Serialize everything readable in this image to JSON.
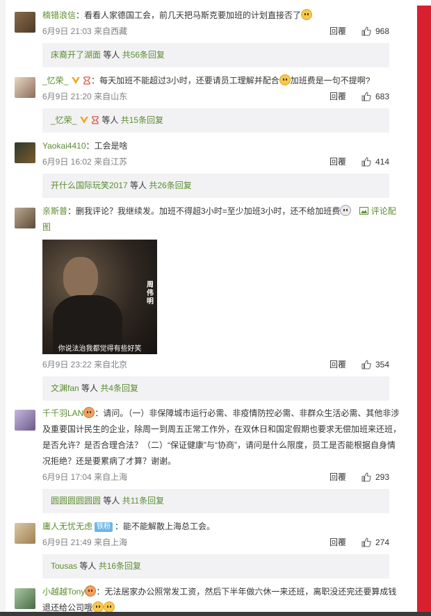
{
  "comments": [
    {
      "user": "楠错浪信",
      "sep": "：",
      "text": "看看人家德国工会，前几天把马斯克要加班的计划直接否了",
      "date": "6月9日 21:03",
      "location": "来自西藏",
      "reply_label": "回覆",
      "likes": "968",
      "reply_user": "床裔开了湖面",
      "reply_mid": " 等人 ",
      "reply_count": "共56条回复"
    },
    {
      "user": "_忆荣_",
      "sep": "：",
      "text": "每天加班不能超过3小时，还要请员工理解并配合",
      "text2": "加班费是一句不提啊?",
      "date": "6月9日 21:20",
      "location": "来自山东",
      "reply_label": "回覆",
      "likes": "683",
      "reply_user": "_忆荣_",
      "reply_mid": " 等人 ",
      "reply_count": "共15条回复"
    },
    {
      "user": "Yaokai4410",
      "sep": "：",
      "text": "工会是啥",
      "date": "6月9日 16:02",
      "location": "来自江苏",
      "reply_label": "回覆",
      "likes": "414",
      "reply_user": "开什么国际玩笑2017",
      "reply_mid": " 等人 ",
      "reply_count": "共26条回复"
    },
    {
      "user": "亲斯普",
      "sep": "：",
      "text": "删我评论？我继续发。加班不得超3小时=至少加班3小时，还不给加班费",
      "pic_label": "评论配图",
      "image_caption": "你说法治我都觉得有些好笑",
      "image_name": "周伟明",
      "date": "6月9日 23:22",
      "location": "来自北京",
      "reply_label": "回覆",
      "likes": "354",
      "reply_user": "文渊fan",
      "reply_mid": " 等人 ",
      "reply_count": "共4条回复"
    },
    {
      "user": "千千羽LAN",
      "sep": "：",
      "text": "请问。（一）非保障城市运行必需、非疫情防控必需、非群众生活必需、其他非涉及重要国计民生的企业，除周一到周五正常工作外，在双休日和国定假期也要求无偿加班来还班，是否允许？是否合理合法？（二）“保证健康”与“协商”，请问是什么限度，员工是否能根据自身情况拒绝？还是要累病了才算？谢谢。",
      "date": "6月9日 17:04",
      "location": "来自上海",
      "reply_label": "回覆",
      "likes": "293",
      "reply_user": "圆圆圆圆圆圆",
      "reply_mid": " 等人 ",
      "reply_count": "共11条回复"
    },
    {
      "user": "庸人无忧无虑",
      "fan_badge": "铁粉",
      "sep": "：",
      "text": "能不能解散上海总工会。",
      "date": "6月9日 21:49",
      "location": "来自上海",
      "reply_label": "回覆",
      "likes": "274",
      "reply_user": "Tousas",
      "reply_mid": " 等人 ",
      "reply_count": "共16条回复"
    },
    {
      "user": "小越越Tony",
      "sep": "：",
      "text": "无法居家办公照常发工资，然后下半年做六休一来还班，离职没还完还要算成钱退还给公司哦"
    }
  ],
  "colors": {
    "username": "#5b8c2e",
    "accent_bar": "#d9202f",
    "reply_bg": "#f2f2f5"
  },
  "icons": {
    "like": "thumbs-up-icon",
    "emoji": "emoji-icon",
    "vip": "v-badge-icon"
  }
}
